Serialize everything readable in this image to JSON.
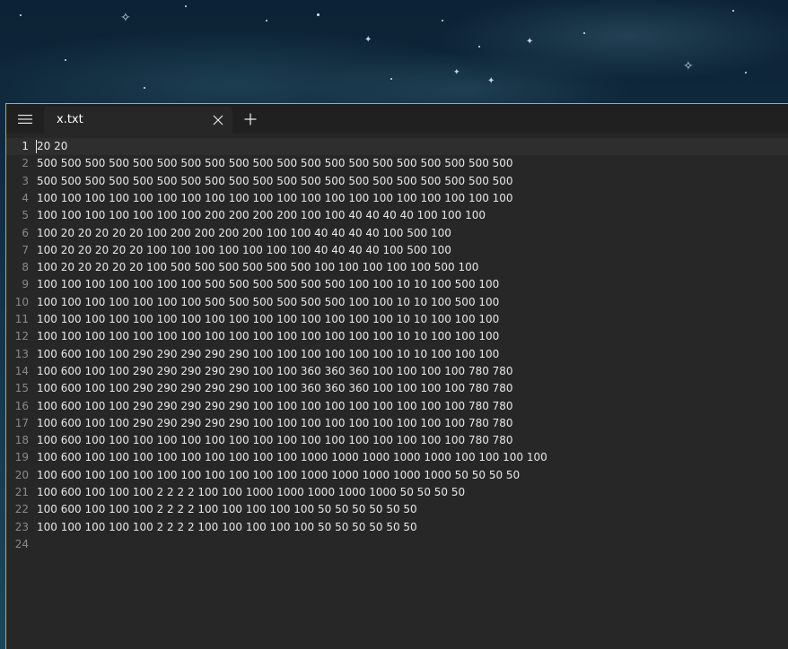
{
  "tab": {
    "title": "x.txt"
  },
  "editor": {
    "lines": [
      {
        "num": "1",
        "text": "20 20"
      },
      {
        "num": "2",
        "text": "500 500 500 500 500 500 500 500 500 500 500 500 500 500 500 500 500 500 500 500"
      },
      {
        "num": "3",
        "text": "500 500 500 500 500 500 500 500 500 500 500 500 500 500 500 500 500 500 500 500"
      },
      {
        "num": "4",
        "text": "100 100 100 100 100 100 100 100 100 100 100 100 100 100 100 100 100 100 100 100"
      },
      {
        "num": "5",
        "text": "100 100 100 100 100 100 100 200 200 200 200 100 100 40 40 40 40 100 100 100"
      },
      {
        "num": "6",
        "text": "100 20 20 20 20 20 100 200 200 200 200 100 100 40 40 40 40 100 500 100"
      },
      {
        "num": "7",
        "text": "100 20 20 20 20 20 100 100 100 100 100 100 100 40 40 40 40 100 500 100"
      },
      {
        "num": "8",
        "text": "100 20 20 20 20 20 100 500 500 500 500 500 500 100 100 100 100 100 500 100"
      },
      {
        "num": "9",
        "text": "100 100 100 100 100 100 100 500 500 500 500 500 500 100 100 10 10 100 500 100"
      },
      {
        "num": "10",
        "text": "100 100 100 100 100 100 100 500 500 500 500 500 500 100 100 10 10 100 500 100"
      },
      {
        "num": "11",
        "text": "100 100 100 100 100 100 100 100 100 100 100 100 100 100 100 10 10 100 100 100"
      },
      {
        "num": "12",
        "text": "100 100 100 100 100 100 100 100 100 100 100 100 100 100 100 10 10 100 100 100"
      },
      {
        "num": "13",
        "text": "100 600 100 100 290 290 290 290 290 100 100 100 100 100 100 10 10 100 100 100"
      },
      {
        "num": "14",
        "text": "100 600 100 100 290 290 290 290 290 100 100 360 360 360 100 100 100 100 780 780"
      },
      {
        "num": "15",
        "text": "100 600 100 100 290 290 290 290 290 100 100 360 360 360 100 100 100 100 780 780"
      },
      {
        "num": "16",
        "text": "100 600 100 100 290 290 290 290 290 100 100 100 100 100 100 100 100 100 780 780"
      },
      {
        "num": "17",
        "text": "100 600 100 100 290 290 290 290 290 100 100 100 100 100 100 100 100 100 780 780"
      },
      {
        "num": "18",
        "text": "100 600 100 100 100 100 100 100 100 100 100 100 100 100 100 100 100 100 780 780"
      },
      {
        "num": "19",
        "text": "100 600 100 100 100 100 100 100 100 100 100 1000 1000 1000 1000 1000 100 100 100 100"
      },
      {
        "num": "20",
        "text": "100 600 100 100 100 100 100 100 100 100 100 1000 1000 1000 1000 1000 50 50 50 50"
      },
      {
        "num": "21",
        "text": "100 600 100 100 100 2 2 2 2 100 100 1000 1000 1000 1000 1000 50 50 50 50"
      },
      {
        "num": "22",
        "text": "100 600 100 100 100 2 2 2 2 100 100 100 100 100 50 50 50 50 50 50"
      },
      {
        "num": "23",
        "text": "100 100 100 100 100 2 2 2 2 100 100 100 100 100 50 50 50 50 50 50"
      },
      {
        "num": "24",
        "text": ""
      }
    ]
  },
  "colors": {
    "window_accent_border": "#d9a520",
    "editor_background": "#272727",
    "titlebar_background": "#202020",
    "text": "#e8e8e8",
    "line_number": "#8a8a8a"
  },
  "icons": {
    "menu": "hamburger-menu-icon",
    "close_tab": "close-icon",
    "new_tab": "plus-icon"
  }
}
